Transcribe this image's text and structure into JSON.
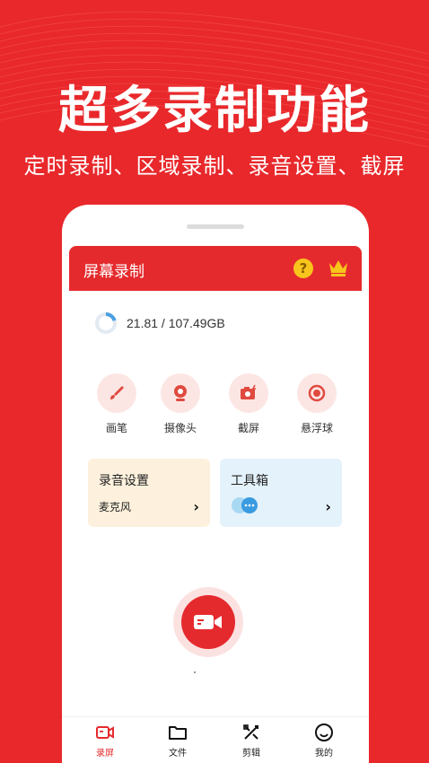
{
  "promo": {
    "headline": "超多录制功能",
    "subline": "定时录制、区域录制、录音设置、截屏"
  },
  "appbar": {
    "title": "屏幕录制",
    "help_icon": "question-icon",
    "vip_icon": "crown-icon",
    "help_glyph": "?"
  },
  "storage": {
    "text": "21.81 / 107.49GB",
    "used_fraction": 0.2029
  },
  "quick_actions": [
    {
      "label": "画笔",
      "icon": "brush-icon"
    },
    {
      "label": "摄像头",
      "icon": "webcam-icon"
    },
    {
      "label": "截屏",
      "icon": "screenshot-camera-icon"
    },
    {
      "label": "悬浮球",
      "icon": "floating-ball-icon"
    }
  ],
  "cards": {
    "recording_settings": {
      "title": "录音设置",
      "value": "麦克风",
      "chevron": "›"
    },
    "toolbox": {
      "title": "工具箱",
      "chevron": "›"
    }
  },
  "record_button": {
    "icon": "video-camera-icon"
  },
  "tabs": [
    {
      "label": "录屏",
      "icon": "record-screen-icon",
      "active": true
    },
    {
      "label": "文件",
      "icon": "folder-icon",
      "active": false
    },
    {
      "label": "剪辑",
      "icon": "edit-tools-icon",
      "active": false
    },
    {
      "label": "我的",
      "icon": "smiley-profile-icon",
      "active": false
    }
  ],
  "colors": {
    "brand_red": "#e52a2d",
    "background_red": "#e8282b",
    "icon_bg_pink": "#fce6e4",
    "card_peach": "#fdf1dd",
    "card_blue": "#e4f2fb",
    "help_yellow": "#f7c51c",
    "storage_blue": "#4a9fe0"
  }
}
